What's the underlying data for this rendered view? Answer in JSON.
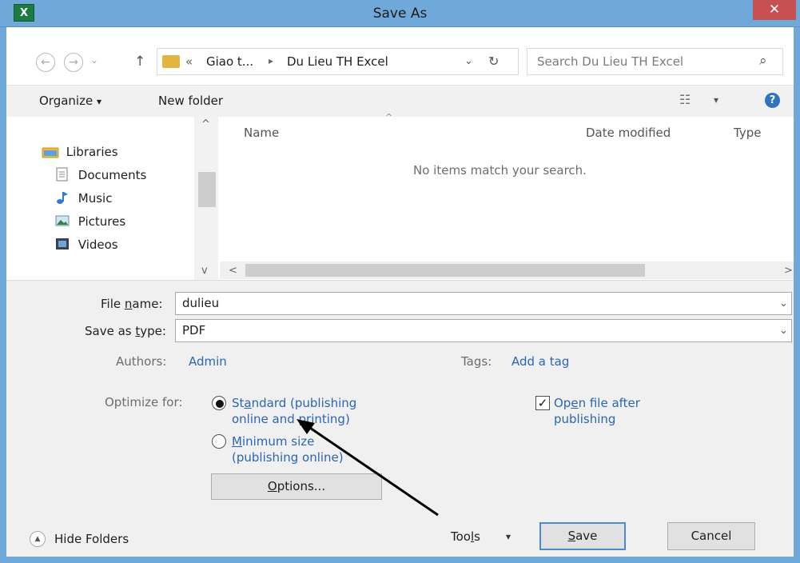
{
  "window": {
    "title": "Save As",
    "app_icon_label": "X",
    "close_glyph": "✕"
  },
  "nav": {
    "back_glyph": "←",
    "forward_glyph": "→",
    "dropdown_glyph": "⌄",
    "up_glyph": "↑"
  },
  "address": {
    "overflow": "«",
    "crumb_1": "Giao t...",
    "separator": "▸",
    "crumb_2": "Du Lieu TH Excel",
    "dropdown_glyph": "⌄",
    "refresh_glyph": "↻"
  },
  "search": {
    "placeholder": "Search Du Lieu TH Excel",
    "icon_glyph": "⌕"
  },
  "toolbar": {
    "organize": "Organize",
    "organize_arrow": "▾",
    "new_folder": "New folder",
    "view_glyph": "☷",
    "view_arrow": "▾",
    "help_glyph": "?"
  },
  "navpane": {
    "items": [
      {
        "label": "Libraries",
        "icon": "libraries-icon"
      },
      {
        "label": "Documents",
        "icon": "documents-icon"
      },
      {
        "label": "Music",
        "icon": "music-icon"
      },
      {
        "label": "Pictures",
        "icon": "pictures-icon"
      },
      {
        "label": "Videos",
        "icon": "videos-icon"
      }
    ],
    "scroll_up": "^",
    "scroll_down": "v"
  },
  "filelist": {
    "columns": [
      "Name",
      "Date modified",
      "Type"
    ],
    "sort_glyph": "^",
    "empty_message": "No items match your search.",
    "scroll_left": "<",
    "scroll_right": ">"
  },
  "form": {
    "filename_label_pre": "File ",
    "filename_label_key": "n",
    "filename_label_post": "ame:",
    "filename_value": "dulieu",
    "savetype_label_pre": "Save as ",
    "savetype_label_key": "t",
    "savetype_label_post": "ype:",
    "savetype_value": "PDF",
    "dropdown_glyph": "⌄",
    "authors_label": "Authors:",
    "authors_value": "Admin",
    "tags_label": "Tags:",
    "tags_value": "Add a tag",
    "optimize_label": "Optimize for:",
    "standard_pre": "St",
    "standard_key": "a",
    "standard_line1_post": "ndard (publishing",
    "standard_line2": "online and printing)",
    "minimum_key": "M",
    "minimum_line1_post": "inimum size",
    "minimum_line2": "(publishing online)",
    "open_file_pre": "Op",
    "open_file_key": "e",
    "open_file_line1_post": "n file after",
    "open_file_line2": "publishing",
    "check_glyph": "✓",
    "options_key": "O",
    "options_post": "ptions..."
  },
  "footer": {
    "hide_folders": "Hide Folders",
    "hide_folders_glyph": "▲",
    "tools_pre": "Too",
    "tools_key": "l",
    "tools_post": "s",
    "tools_arrow": "▾",
    "save_key": "S",
    "save_post": "ave",
    "cancel": "Cancel"
  },
  "colors": {
    "titlebar": "#6fa9d9",
    "close": "#c75050",
    "link": "#2a66b4",
    "primary_border": "#4a8ad4"
  }
}
